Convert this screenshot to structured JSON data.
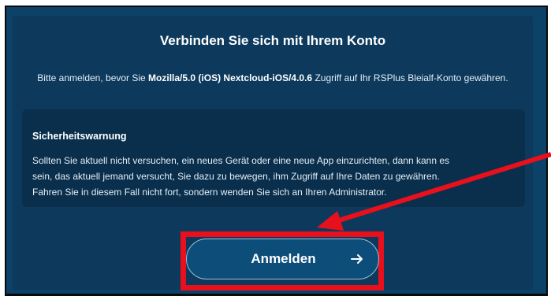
{
  "title": "Verbinden Sie sich mit Ihrem Konto",
  "intro": {
    "before": "Bitte anmelden, bevor Sie ",
    "client": "Mozilla/5.0 (iOS) Nextcloud-iOS/4.0.6",
    "after": " Zugriff auf Ihr RSPlus Bleialf-Konto gewähren."
  },
  "warning": {
    "title": "Sicherheitswarnung",
    "line1": "Sollten Sie aktuell nicht versuchen, ein neues Gerät oder eine neue App einzurichten, dann kann es",
    "line2": "sein, das aktuell jemand versucht, Sie dazu zu bewegen, ihm Zugriff auf Ihre Daten zu gewähren.",
    "line3": "Fahren Sie in diesem Fall nicht fort, sondern wenden Sie sich an Ihren Administrator."
  },
  "login_button": {
    "label": "Anmelden",
    "icon": "arrow-right-icon"
  },
  "colors": {
    "background": "#0c4267",
    "panel": "#0d3a5c",
    "warning_box": "#0a2f4c",
    "button": "#0d4d7a",
    "annotation": "#e8101c"
  }
}
